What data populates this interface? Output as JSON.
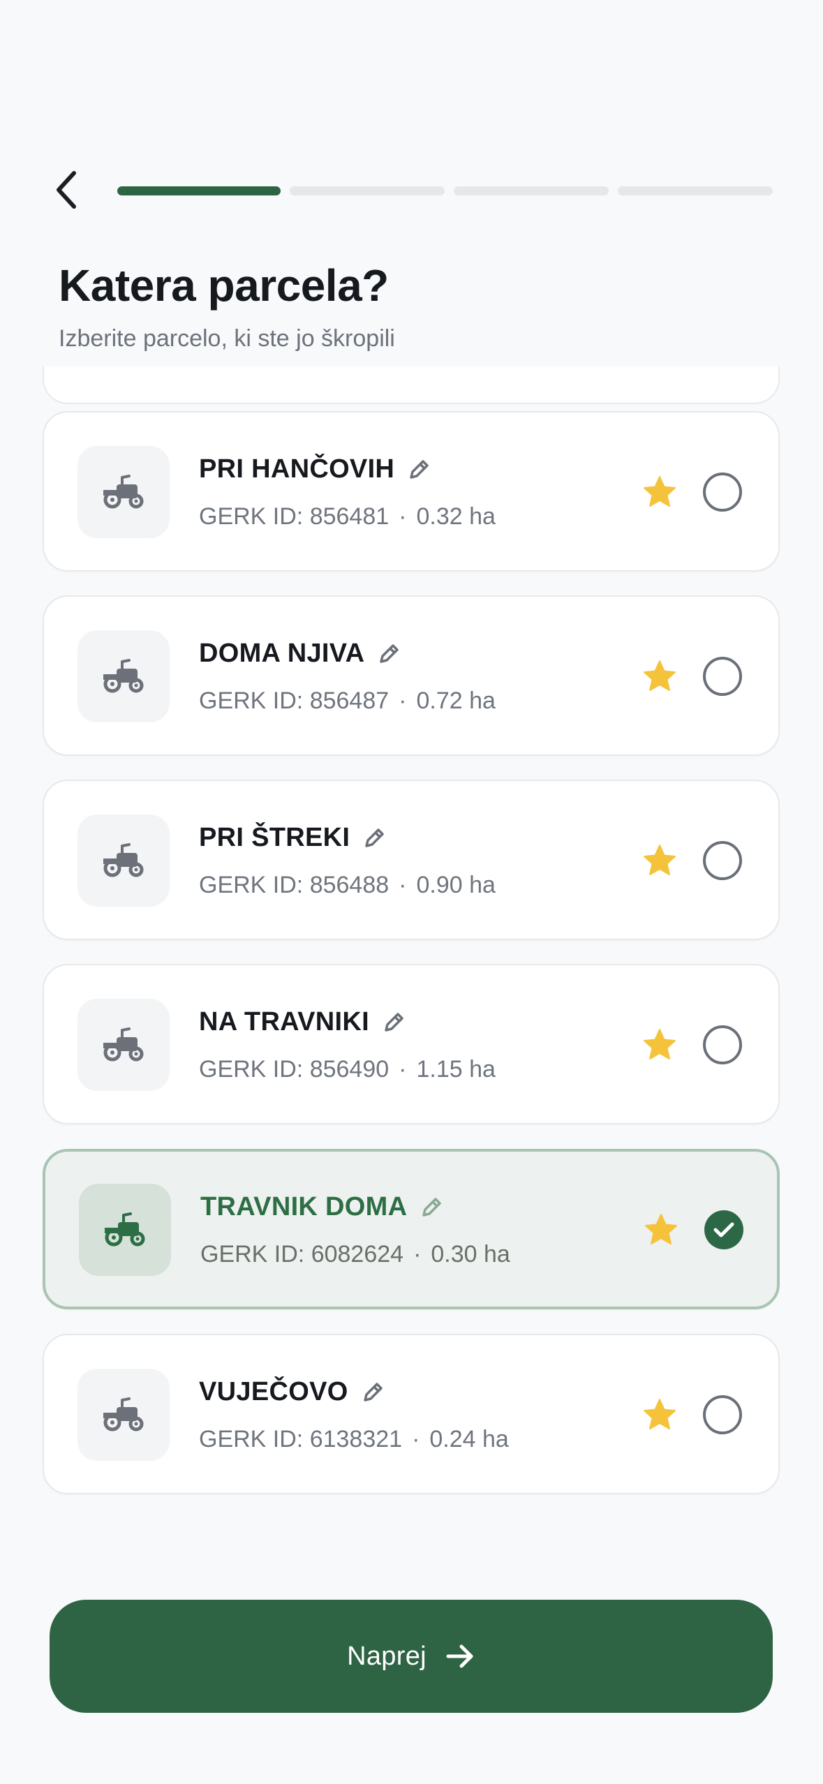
{
  "header": {
    "back_icon": "chevron-left-icon",
    "progress": {
      "current_step": 1,
      "total_steps": 4
    },
    "title": "Katera parcela?",
    "subtitle": "Izberite parcelo, ki ste jo škropili"
  },
  "parcels": [
    {
      "name": "PRI HANČOVIH",
      "gerk": "GERK ID: 856481",
      "area": "0.32 ha",
      "favorite": true,
      "selected": false
    },
    {
      "name": "DOMA NJIVA",
      "gerk": "GERK ID: 856487",
      "area": "0.72 ha",
      "favorite": true,
      "selected": false
    },
    {
      "name": "PRI ŠTREKI",
      "gerk": "GERK ID: 856488",
      "area": "0.90 ha",
      "favorite": true,
      "selected": false
    },
    {
      "name": "NA TRAVNIKI",
      "gerk": "GERK ID: 856490",
      "area": "1.15 ha",
      "favorite": true,
      "selected": false
    },
    {
      "name": "TRAVNIK DOMA",
      "gerk": "GERK ID: 6082624",
      "area": "0.30 ha",
      "favorite": true,
      "selected": true
    },
    {
      "name": "VUJEČOVO",
      "gerk": "GERK ID: 6138321",
      "area": "0.24 ha",
      "favorite": true,
      "selected": false
    }
  ],
  "meta_separator": "·",
  "footer": {
    "next_label": "Naprej",
    "next_icon": "arrow-right-icon"
  },
  "colors": {
    "accent": "#2e6344",
    "selected_bg": "#edf1ef",
    "star": "#f5c33b",
    "progress_active": "#2e6344",
    "progress_inactive": "#e6e7ea"
  }
}
